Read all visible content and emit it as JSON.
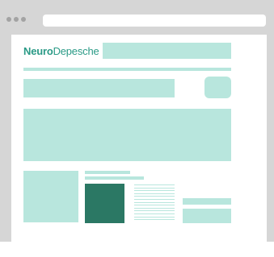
{
  "logo": {
    "bold": "Neuro",
    "light": "Depesche"
  },
  "colors": {
    "accent": "#b8e6dd",
    "accent_dark": "#2b7864",
    "frame": "#d6d6d6",
    "dots": "#a3a3a3"
  },
  "window_controls": [
    "dot",
    "dot",
    "dot"
  ]
}
